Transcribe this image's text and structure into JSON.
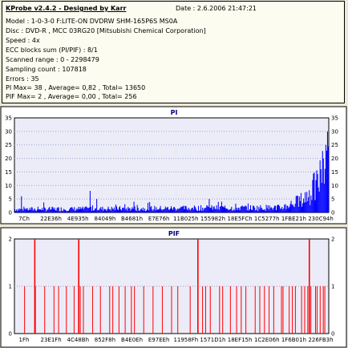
{
  "header": {
    "title": "KProbe v2.4.2 - Designed by Karr",
    "date": "Date : 2.6.2006 21:47:21",
    "model": "Model : 1-0-3-0 F:LITE-ON DVDRW SHM-165P6S MS0A",
    "disc": "Disc : DVD-R , MCC 03RG20  [Mitsubishi Chemical Corporation]",
    "speed": "Speed : 4x",
    "ecc": "ECC blocks sum (PI/PIF) : 8/1",
    "scanned_range": "Scanned range : 0 - 2298479",
    "sampling_count": "Sampling count : 107818",
    "errors": "Errors : 35",
    "pi_stats": "PI Max= 38 , Average= 0,82 , Total= 13650",
    "pif_stats": "PIF Max= 2 , Average= 0,00 , Total= 256"
  },
  "chart_data": [
    {
      "type": "bar",
      "title": "PI",
      "ylim": [
        0,
        35
      ],
      "yticks": [
        0,
        5,
        10,
        15,
        20,
        25,
        30,
        35
      ],
      "xlabels": [
        "7Ch",
        "22E36h",
        "4E935h",
        "84049h",
        "B4681h",
        "E7E76h",
        "11B025h",
        "155982h",
        "18E5FCh",
        "1C5277h",
        "1FBE21h",
        "230C94h"
      ],
      "max": 38,
      "average": 0.82,
      "bar_color": "#0000ff",
      "grid": true,
      "bins": 380,
      "tail_profile": [
        {
          "x_frac": 0.0,
          "y": 1
        },
        {
          "x_frac": 0.85,
          "y": 1.5
        },
        {
          "x_frac": 0.92,
          "y": 4
        },
        {
          "x_frac": 0.96,
          "y": 8
        },
        {
          "x_frac": 0.99,
          "y": 14
        },
        {
          "x_frac": 1.0,
          "y": 18
        }
      ],
      "spikes": [
        {
          "x_frac": 0.02,
          "y": 6
        },
        {
          "x_frac": 0.24,
          "y": 8
        },
        {
          "x_frac": 0.26,
          "y": 5
        },
        {
          "x_frac": 0.38,
          "y": 4
        },
        {
          "x_frac": 0.62,
          "y": 5
        },
        {
          "x_frac": 0.66,
          "y": 4
        },
        {
          "x_frac": 0.95,
          "y": 12
        },
        {
          "x_frac": 0.975,
          "y": 16
        },
        {
          "x_frac": 0.985,
          "y": 20
        },
        {
          "x_frac": 0.993,
          "y": 25
        },
        {
          "x_frac": 0.997,
          "y": 30
        }
      ]
    },
    {
      "type": "bar",
      "title": "PIF",
      "ylim": [
        0,
        2
      ],
      "yticks": [
        0,
        1,
        2
      ],
      "xlabels": [
        "1Fh",
        "23E1Fh",
        "4C48Bh",
        "852F8h",
        "B4E0Eh",
        "E97EEh",
        "11958Fh",
        "1571D1h",
        "18EF15h",
        "1C2E06h",
        "1F6B01h",
        "226FB3h"
      ],
      "max": 2,
      "bar_color": "#ff0000",
      "grid": true,
      "ones": [
        0.025,
        0.06,
        0.09,
        0.12,
        0.135,
        0.16,
        0.185,
        0.205,
        0.215,
        0.245,
        0.27,
        0.3,
        0.31,
        0.33,
        0.35,
        0.37,
        0.38,
        0.41,
        0.44,
        0.47,
        0.5,
        0.52,
        0.56,
        0.6,
        0.61,
        0.625,
        0.655,
        0.665,
        0.69,
        0.71,
        0.725,
        0.74,
        0.77,
        0.785,
        0.8,
        0.815,
        0.83,
        0.855,
        0.86,
        0.88,
        0.89,
        0.9,
        0.92,
        0.93,
        0.94,
        0.95,
        0.965,
        0.97,
        0.98,
        0.99,
        0.995
      ],
      "twos": [
        0.058,
        0.2,
        0.585,
        0.945
      ]
    }
  ]
}
